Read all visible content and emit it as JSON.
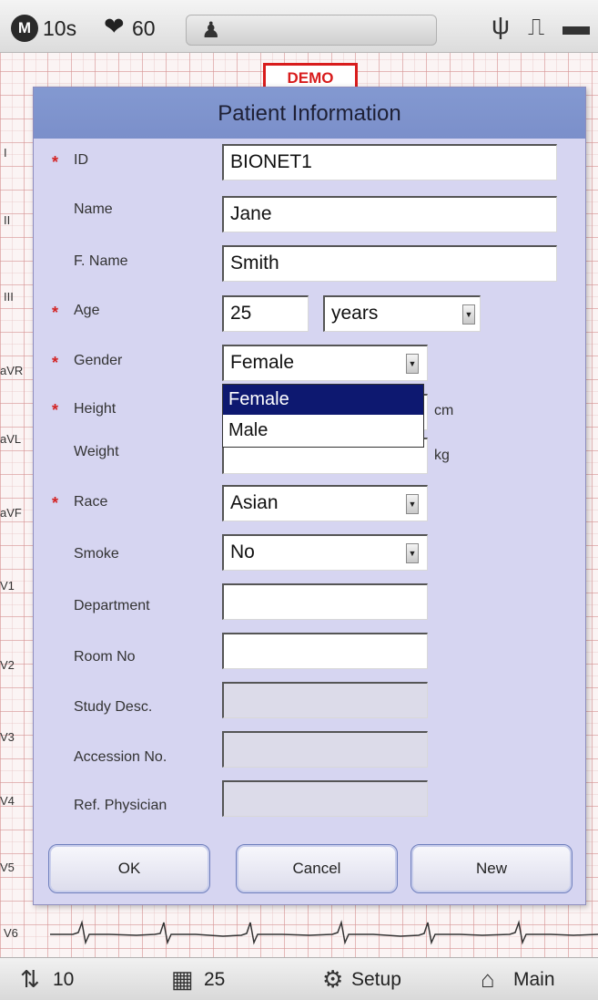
{
  "status_bar": {
    "mode_letter": "M",
    "speed": "10s",
    "heart_rate": "60"
  },
  "leads": [
    "I",
    "II",
    "III",
    "aVR",
    "aVL",
    "aVF",
    "V1",
    "V2",
    "V3",
    "V4",
    "V5",
    "V6"
  ],
  "demo_label": "DEMO",
  "dialog": {
    "title": "Patient Information",
    "fields": {
      "id": {
        "label": "ID",
        "value": "BIONET1"
      },
      "name": {
        "label": "Name",
        "value": "Jane"
      },
      "fname": {
        "label": "F. Name",
        "value": "Smith"
      },
      "age": {
        "label": "Age",
        "value": "25",
        "unit_select": "years"
      },
      "gender": {
        "label": "Gender",
        "value": "Female"
      },
      "height": {
        "label": "Height",
        "value": "",
        "unit": "cm"
      },
      "weight": {
        "label": "Weight",
        "value": "",
        "unit": "kg"
      },
      "race": {
        "label": "Race",
        "value": "Asian"
      },
      "smoke": {
        "label": "Smoke",
        "value": "No"
      },
      "department": {
        "label": "Department",
        "value": ""
      },
      "room_no": {
        "label": "Room No",
        "value": ""
      },
      "study_desc": {
        "label": "Study Desc.",
        "value": ""
      },
      "accession_no": {
        "label": "Accession No.",
        "value": ""
      },
      "ref_physician": {
        "label": "Ref. Physician",
        "value": ""
      }
    },
    "gender_options": [
      "Female",
      "Male"
    ],
    "buttons": {
      "ok": "OK",
      "cancel": "Cancel",
      "new": "New"
    }
  },
  "bottom_bar": {
    "speed_value": "10",
    "gain_value": "25",
    "setup_label": "Setup",
    "main_label": "Main"
  },
  "colors": {
    "dialog_bg": "#d6d5f1",
    "title_bar": "#7b8fca",
    "required_marker": "#d32424",
    "selected_option": "#0d1870",
    "demo_border": "#d81c1c",
    "grid": "#d79696"
  }
}
